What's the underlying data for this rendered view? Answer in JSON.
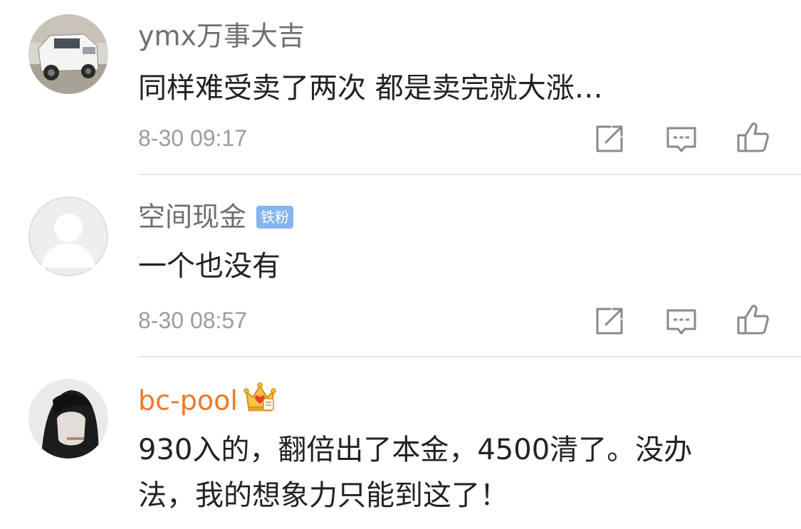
{
  "comments": [
    {
      "username": "ymx万事大吉",
      "content": "同样难受卖了两次 都是卖完就大涨…",
      "timestamp": "8-30 09:17"
    },
    {
      "username": "空间现金",
      "badge": "铁粉",
      "content": "一个也没有",
      "timestamp": "8-30 08:57"
    },
    {
      "username": "bc-pool",
      "content_line1": "930入的，翻倍出了本金，4500清了。没办",
      "content_line2": "法，我的想象力只能到这了！"
    }
  ],
  "colors": {
    "username": "#6f6f6f",
    "vip_username": "#eb7a2a",
    "badge_bg": "#85b5ec",
    "content": "#222222",
    "timestamp": "#9c9c9c",
    "icon": "#8a8a8a",
    "divider": "#e7e7e7"
  },
  "icons": [
    "edit-icon",
    "comment-icon",
    "like-icon",
    "crown-icon"
  ]
}
